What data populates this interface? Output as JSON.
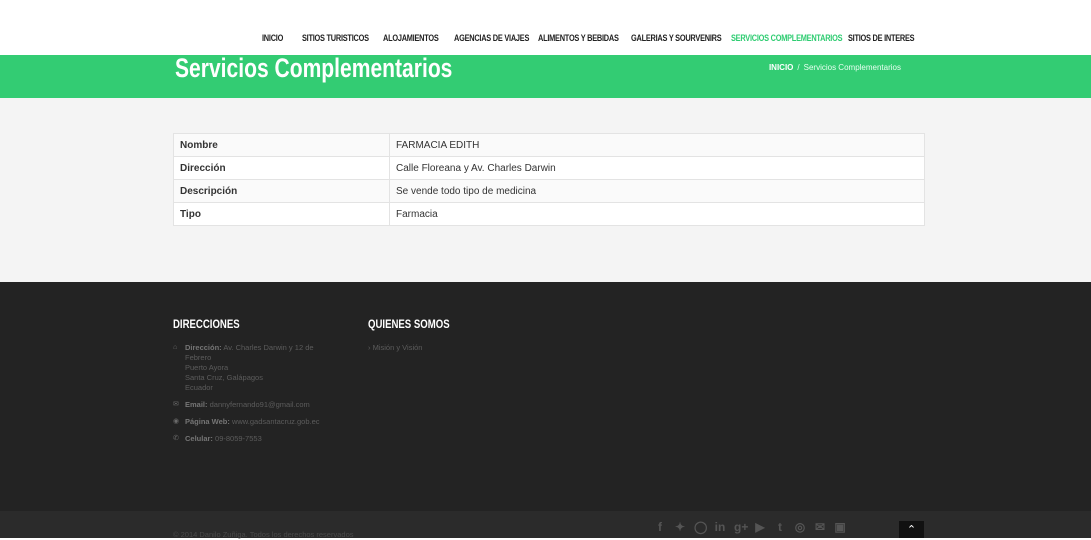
{
  "nav": {
    "items": [
      {
        "label": "INICIO",
        "active": false
      },
      {
        "label": "SITIOS TURISTICOS",
        "active": false
      },
      {
        "label": "ALOJAMIENTOS",
        "active": false
      },
      {
        "label": "AGENCIAS DE VIAJES",
        "active": false
      },
      {
        "label": "ALIMENTOS Y BEBIDAS",
        "active": false
      },
      {
        "label": "GALERIAS Y SOURVENIRS",
        "active": false
      },
      {
        "label": "SERVICIOS COMPLEMENTARIOS",
        "active": true
      },
      {
        "label": "SITIOS DE INTERES",
        "active": false
      }
    ]
  },
  "banner": {
    "title": "Servicios Complementarios",
    "breadcrumb_home": "INICIO",
    "breadcrumb_sep": "/",
    "breadcrumb_current": "Servicios Complementarios"
  },
  "details": {
    "rows": [
      {
        "key": "Nombre",
        "value": "FARMACIA EDITH"
      },
      {
        "key": "Dirección",
        "value": "Calle Floreana y Av. Charles Darwin"
      },
      {
        "key": "Descripción",
        "value": "Se vende todo tipo de medicina"
      },
      {
        "key": "Tipo",
        "value": "Farmacia"
      }
    ]
  },
  "footer": {
    "col1_title": "DIRECCIONES",
    "address_label": "Dirección:",
    "address_line1": "Av. Charles Darwin y 12 de",
    "address_line2": "Febrero",
    "address_line3": "Puerto Ayora",
    "address_line4": "Santa Cruz, Galápagos",
    "address_line5": "Ecuador",
    "email_label": "Email:",
    "email_value": "dannyfernando91@gmail.com",
    "web_label": "Página Web:",
    "web_value": "www.gadsantacruz.gob.ec",
    "phone_label": "Celular:",
    "phone_value": "09-8059-7553",
    "col2_title": "QUIENES SOMOS",
    "col2_link": "› Misión y Visión"
  },
  "bottom": {
    "copyright": "© 2014 Danilo Zuñiga. Todos los derechos reservados",
    "social_icons": [
      "facebook-icon",
      "twitter-icon",
      "pinterest-icon",
      "linkedin-icon",
      "google-plus-icon",
      "youtube-icon",
      "tumblr-icon",
      "dribbble-icon",
      "email-icon",
      "instagram-icon"
    ],
    "to_top_icon": "chevron-up-icon"
  },
  "colors": {
    "accent": "#33cc73",
    "footer_bg": "#232323",
    "bottombar_bg": "#2b2b2b"
  }
}
